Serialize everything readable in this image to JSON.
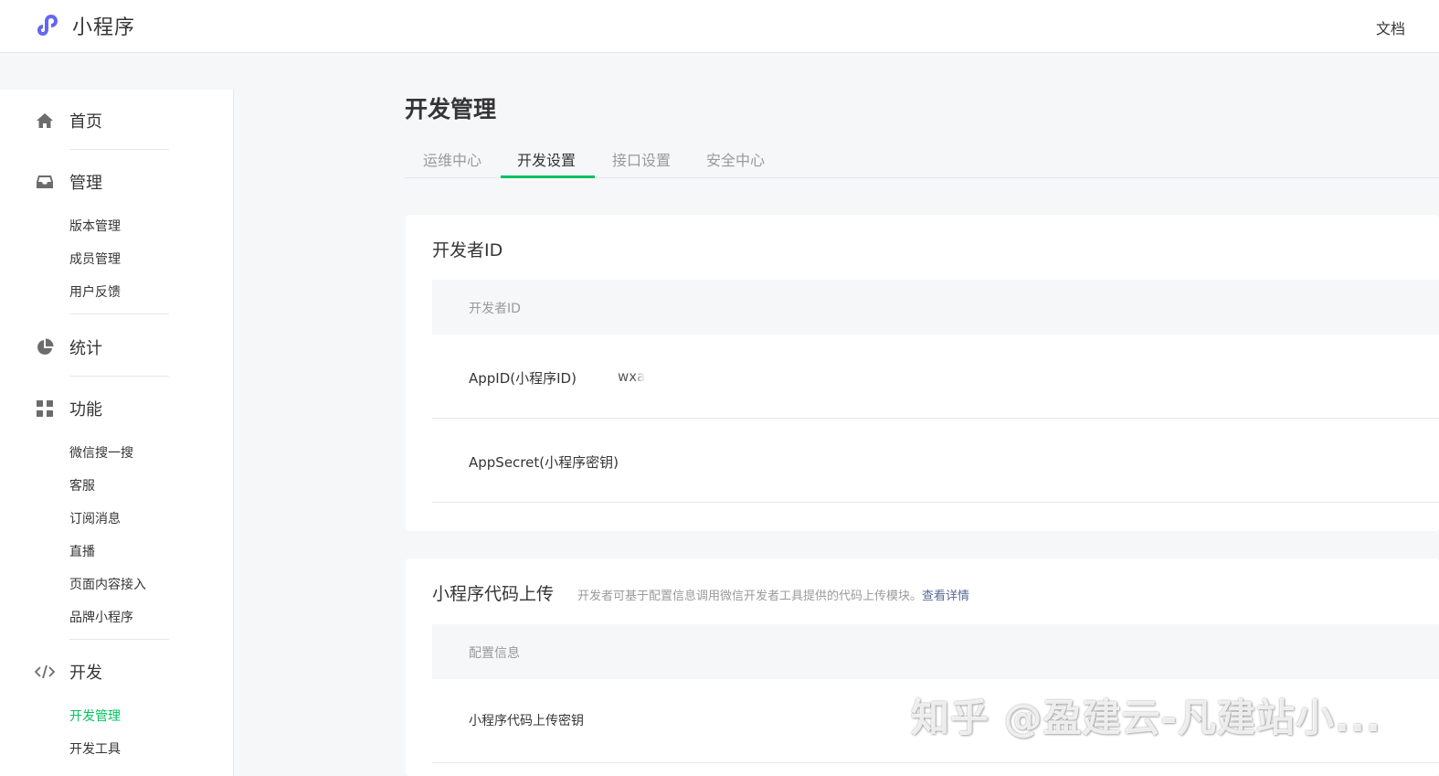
{
  "header": {
    "brand_name": "小程序",
    "doc_link": "文档"
  },
  "sidebar": {
    "home": {
      "label": "首页",
      "icon": "home-icon"
    },
    "manage": {
      "label": "管理",
      "icon": "inbox-icon",
      "items": [
        "版本管理",
        "成员管理",
        "用户反馈"
      ]
    },
    "stats": {
      "label": "统计",
      "icon": "pie-chart-icon"
    },
    "features": {
      "label": "功能",
      "icon": "grid-icon",
      "items": [
        "微信搜一搜",
        "客服",
        "订阅消息",
        "直播",
        "页面内容接入",
        "品牌小程序"
      ]
    },
    "develop": {
      "label": "开发",
      "icon": "code-icon",
      "items": [
        "开发管理",
        "开发工具"
      ],
      "active_item": "开发管理"
    }
  },
  "main": {
    "title": "开发管理",
    "tabs": [
      "运维中心",
      "开发设置",
      "接口设置",
      "安全中心"
    ],
    "active_tab": "开发设置",
    "developer_id": {
      "title": "开发者ID",
      "table_header": "开发者ID",
      "rows": [
        {
          "label": "AppID(小程序ID)",
          "value": "wxa"
        },
        {
          "label": "AppSecret(小程序密钥)",
          "value": ""
        }
      ]
    },
    "code_upload": {
      "title": "小程序代码上传",
      "desc": "开发者可基于配置信息调用微信开发者工具提供的代码上传模块。",
      "desc_link": "查看详情",
      "table_header": "配置信息",
      "rows": [
        {
          "label": "小程序代码上传密钥"
        }
      ]
    }
  },
  "watermark": "知乎 @盈建云-凡建站小...",
  "colors": {
    "accent": "#07c160",
    "brand_logo": "#6467f0",
    "link": "#576b95"
  }
}
